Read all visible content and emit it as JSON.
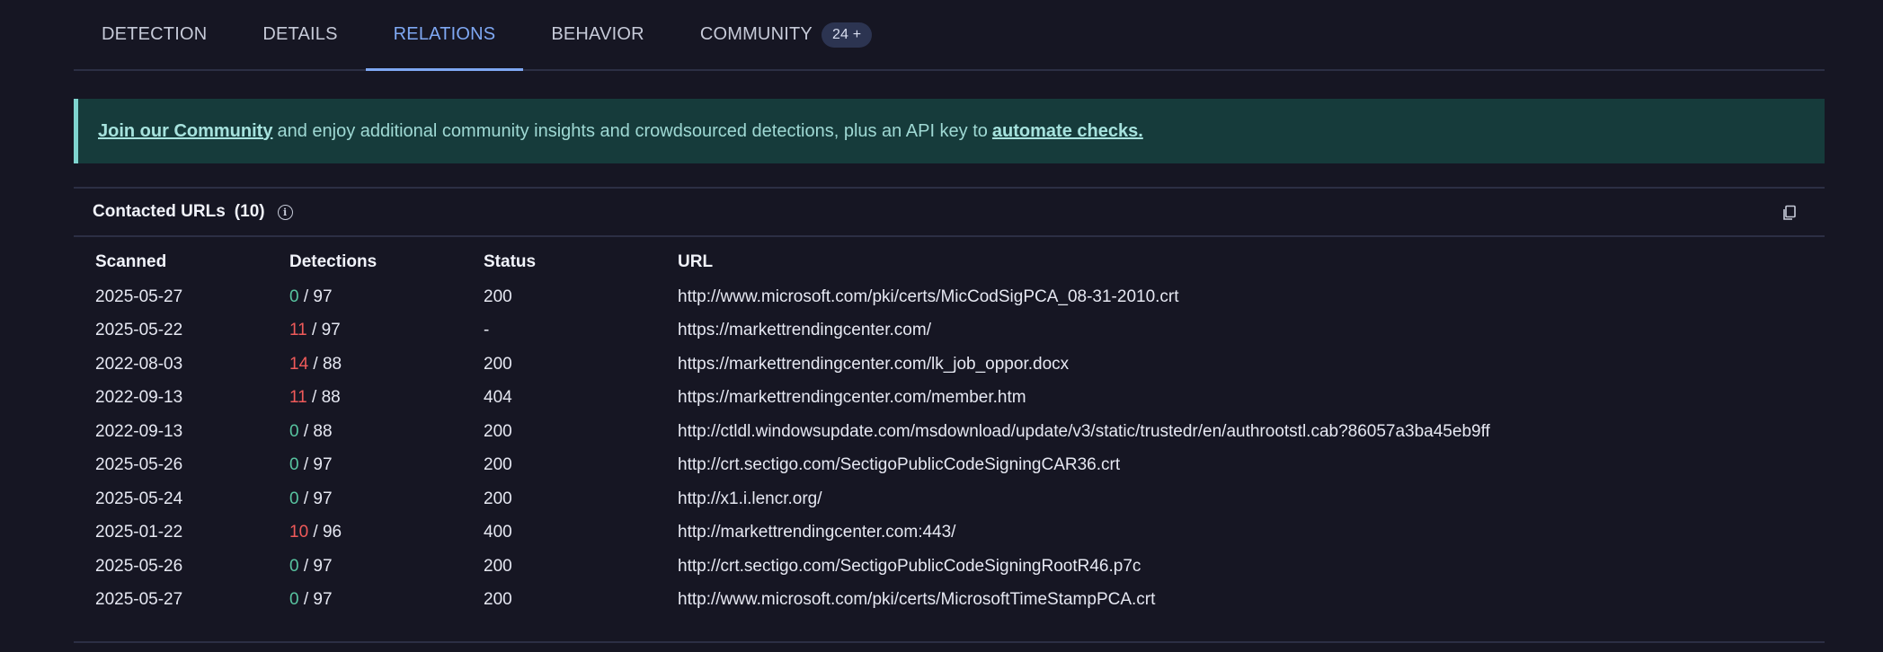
{
  "tabs": [
    {
      "label": "DETECTION"
    },
    {
      "label": "DETAILS"
    },
    {
      "label": "RELATIONS"
    },
    {
      "label": "BEHAVIOR"
    },
    {
      "label": "COMMUNITY",
      "badge": "24 +"
    }
  ],
  "active_tab": "RELATIONS",
  "banner": {
    "link1": "Join our Community",
    "text": "and enjoy additional community insights and crowdsourced detections, plus an API key to",
    "link2": "automate checks."
  },
  "section": {
    "title": "Contacted URLs",
    "count": "(10)",
    "info_icon": "info-icon",
    "copy_icon": "copy-icon"
  },
  "table": {
    "headers": [
      "Scanned",
      "Detections",
      "Status",
      "URL"
    ],
    "rows": [
      {
        "scanned": "2025-05-27",
        "pos": "0",
        "total": " / 97",
        "status": "200",
        "url": "http://www.microsoft.com/pki/certs/MicCodSigPCA_08-31-2010.crt"
      },
      {
        "scanned": "2025-05-22",
        "pos": "11",
        "total": " / 97",
        "status": "-",
        "url": "https://markettrendingcenter.com/"
      },
      {
        "scanned": "2022-08-03",
        "pos": "14",
        "total": " / 88",
        "status": "200",
        "url": "https://markettrendingcenter.com/lk_job_oppor.docx"
      },
      {
        "scanned": "2022-09-13",
        "pos": "11",
        "total": " / 88",
        "status": "404",
        "url": "https://markettrendingcenter.com/member.htm"
      },
      {
        "scanned": "2022-09-13",
        "pos": "0",
        "total": " / 88",
        "status": "200",
        "url": "http://ctldl.windowsupdate.com/msdownload/update/v3/static/trustedr/en/authrootstl.cab?86057a3ba45eb9ff"
      },
      {
        "scanned": "2025-05-26",
        "pos": "0",
        "total": " / 97",
        "status": "200",
        "url": "http://crt.sectigo.com/SectigoPublicCodeSigningCAR36.crt"
      },
      {
        "scanned": "2025-05-24",
        "pos": "0",
        "total": " / 97",
        "status": "200",
        "url": "http://x1.i.lencr.org/"
      },
      {
        "scanned": "2025-01-22",
        "pos": "10",
        "total": " / 96",
        "status": "400",
        "url": "http://markettrendingcenter.com:443/"
      },
      {
        "scanned": "2025-05-26",
        "pos": "0",
        "total": " / 97",
        "status": "200",
        "url": "http://crt.sectigo.com/SectigoPublicCodeSigningRootR46.p7c"
      },
      {
        "scanned": "2025-05-27",
        "pos": "0",
        "total": " / 97",
        "status": "200",
        "url": "http://www.microsoft.com/pki/certs/MicrosoftTimeStampPCA.crt"
      }
    ]
  },
  "colors": {
    "clean": "#58c4a0",
    "malicious": "#ef5a5a",
    "accent": "#7fa8f3",
    "banner_bg": "#163b3b"
  }
}
